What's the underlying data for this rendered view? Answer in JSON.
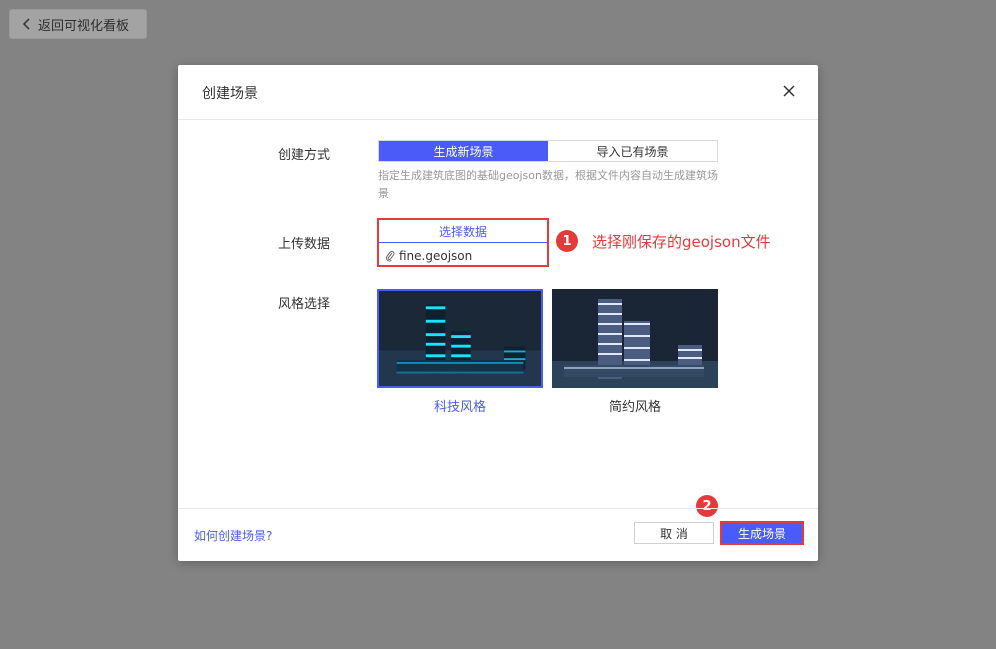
{
  "back": {
    "label": "返回可视化看板"
  },
  "dialog": {
    "title": "创建场景",
    "create_mode": {
      "label": "创建方式",
      "options": [
        "生成新场景",
        "导入已有场景"
      ],
      "selected": "生成新场景",
      "hint": "指定生成建筑底图的基础geojson数据，根据文件内容自动生成建筑场景"
    },
    "upload": {
      "label": "上传数据",
      "select_label": "选择数据",
      "file_name": "fine.geojson"
    },
    "style": {
      "label": "风格选择",
      "options": [
        "科技风格",
        "简约风格"
      ],
      "selected": "科技风格"
    },
    "footer": {
      "help_link": "如何创建场景?",
      "cancel_label": "取 消",
      "confirm_label": "生成场景"
    }
  },
  "annotations": {
    "step1": {
      "number": "1",
      "text": "选择刚保存的geojson文件"
    },
    "step2": {
      "number": "2"
    }
  },
  "colors": {
    "accent": "#4a5bf7",
    "annotation": "#e53a3a",
    "overlay": "#838383"
  }
}
